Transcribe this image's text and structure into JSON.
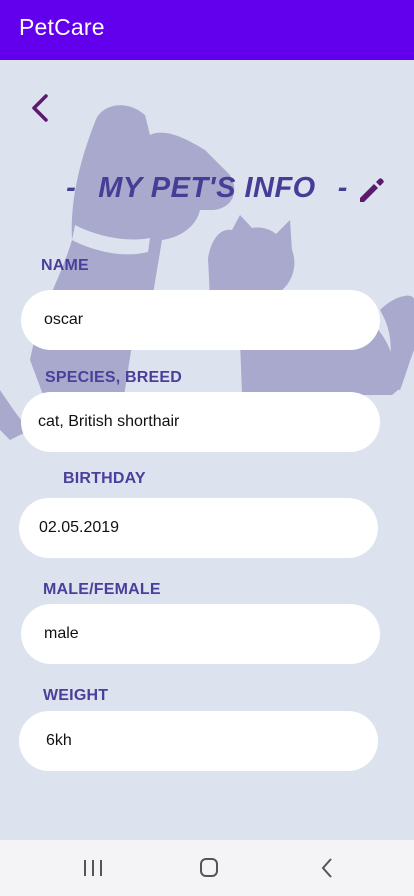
{
  "app": {
    "title": "PetCare"
  },
  "page": {
    "title": "MY PET'S INFO",
    "dash_left": "-",
    "dash_right": "-"
  },
  "fields": {
    "name": {
      "label": "NAME",
      "value": "oscar"
    },
    "species": {
      "label": "SPECIES, BREED",
      "value": "cat, British shorthair"
    },
    "birthday": {
      "label": "BIRTHDAY",
      "value": "02.05.2019"
    },
    "sex": {
      "label": "MALE/FEMALE",
      "value": "male"
    },
    "weight": {
      "label": "WEIGHT",
      "value": "6kh"
    }
  },
  "icons": {
    "back": "back-arrow-icon",
    "edit": "pencil-icon",
    "nav_recents": "recent-apps-icon",
    "nav_home": "home-icon",
    "nav_back": "nav-back-icon"
  },
  "colors": {
    "app_bar": "#6200ee",
    "background": "#dde2ef",
    "accent": "#483d96",
    "icon": "#5a1a6e",
    "silhouette": "#a9a9cd"
  }
}
